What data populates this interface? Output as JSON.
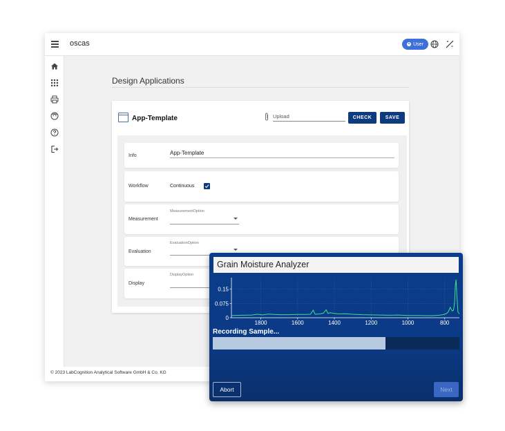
{
  "topbar": {
    "app_name": "oscas",
    "user_label": "User"
  },
  "sidebar": {
    "items": [
      {
        "icon": "home-icon"
      },
      {
        "icon": "apps-grid-icon"
      },
      {
        "icon": "printer-icon"
      },
      {
        "icon": "face-icon"
      },
      {
        "icon": "help-icon"
      },
      {
        "icon": "logout-icon"
      }
    ]
  },
  "page": {
    "title": "Design Applications"
  },
  "card": {
    "title": "App-Template",
    "upload_placeholder": "Upload",
    "check_label": "CHECK",
    "save_label": "SAVE",
    "rows": {
      "info": {
        "label": "Info",
        "value": "App-Template"
      },
      "workflow": {
        "label": "Workflow",
        "value": "Continuous",
        "checked": true
      },
      "measurement": {
        "label": "Measurement",
        "field_label": "MeasurementOption"
      },
      "evaluation": {
        "label": "Evaluation",
        "field_label": "EvaluationOption"
      },
      "display": {
        "label": "Display",
        "field_label": "DisplayOption"
      }
    }
  },
  "footer": {
    "copyright": "© 2023 LabCognition Analytical Software GmbH & Co. KG"
  },
  "analyzer": {
    "title": "Grain Moisture Analyzer",
    "status": "Recording Sample...",
    "progress": 0.7,
    "abort_label": "Abort",
    "next_label": "Next"
  },
  "colors": {
    "accent": "#0d3b80",
    "chip": "#3f6fd8",
    "spectrum": "#3fe08a"
  },
  "chart_data": {
    "type": "line",
    "xlabel": "",
    "ylabel": "",
    "xlim": [
      1960,
      720
    ],
    "ylim": [
      0,
      0.21
    ],
    "x_ticks": [
      "1800",
      "1600",
      "1400",
      "1200",
      "1000",
      "800"
    ],
    "y_ticks": [
      "0",
      "0.075",
      "0.15"
    ],
    "grid": true,
    "series": [
      {
        "x": [
          1960,
          1900,
          1850,
          1820,
          1790,
          1760,
          1700,
          1650,
          1600,
          1560,
          1530,
          1515,
          1505,
          1480,
          1460,
          1445,
          1435,
          1425,
          1410,
          1380,
          1340,
          1300,
          1250,
          1200,
          1150,
          1100,
          1050,
          1000,
          950,
          900,
          870,
          850,
          830,
          810,
          800,
          790,
          780,
          770,
          760,
          752,
          746,
          742,
          738,
          734,
          728,
          720
        ],
        "y": [
          0.012,
          0.013,
          0.014,
          0.018,
          0.015,
          0.019,
          0.016,
          0.016,
          0.017,
          0.017,
          0.018,
          0.04,
          0.018,
          0.02,
          0.024,
          0.042,
          0.022,
          0.026,
          0.024,
          0.02,
          0.021,
          0.018,
          0.016,
          0.015,
          0.014,
          0.013,
          0.014,
          0.012,
          0.012,
          0.011,
          0.011,
          0.012,
          0.013,
          0.016,
          0.018,
          0.022,
          0.032,
          0.055,
          0.036,
          0.04,
          0.08,
          0.17,
          0.2,
          0.12,
          0.03,
          0.02
        ]
      }
    ]
  }
}
